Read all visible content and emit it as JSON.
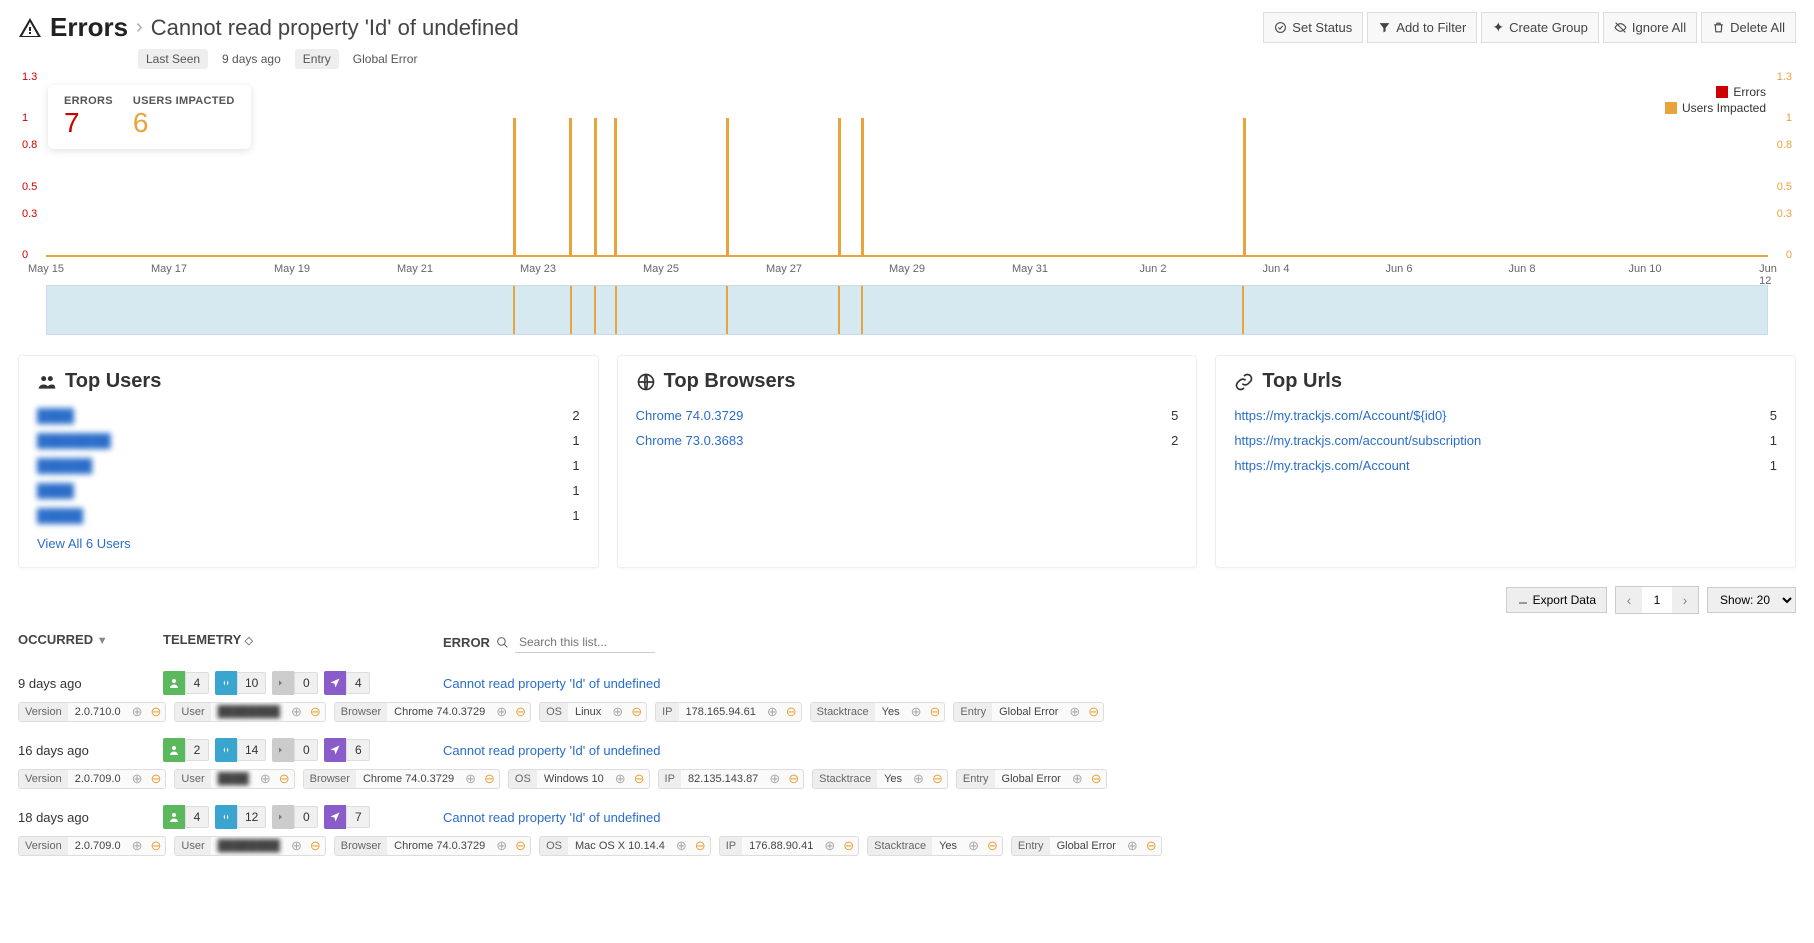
{
  "header": {
    "title": "Errors",
    "description": "Cannot read property 'Id' of undefined",
    "meta": {
      "lastSeenLabel": "Last Seen",
      "lastSeenValue": "9 days ago",
      "entryLabel": "Entry",
      "entryValue": "Global Error"
    },
    "actions": {
      "setStatus": "Set Status",
      "addFilter": "Add to Filter",
      "createGroup": "Create Group",
      "ignoreAll": "Ignore All",
      "deleteAll": "Delete All"
    }
  },
  "stats": {
    "errorsLabel": "ERRORS",
    "errorsValue": "7",
    "usersLabel": "USERS IMPACTED",
    "usersValue": "6"
  },
  "legend": {
    "errors": "Errors",
    "users": "Users Impacted"
  },
  "chart_data": {
    "type": "bar",
    "ylabel_left": "Errors",
    "ylabel_right": "Users Impacted",
    "ylim": [
      0,
      1.3
    ],
    "y_ticks": [
      "0",
      "0.3",
      "0.5",
      "0.8",
      "1",
      "1.3"
    ],
    "x_ticks": [
      "May 15",
      "May 17",
      "May 19",
      "May 21",
      "May 23",
      "May 25",
      "May 27",
      "May 29",
      "May 31",
      "Jun 2",
      "Jun 4",
      "Jun 6",
      "Jun 8",
      "Jun 10",
      "Jun 12"
    ],
    "series": [
      {
        "name": "Errors",
        "color": "#c00",
        "points": []
      },
      {
        "name": "Users Impacted",
        "color": "#e8a33d",
        "points": [
          {
            "x": "May 21",
            "value": 1
          },
          {
            "x": "May 22",
            "value": 1
          },
          {
            "x": "May 22.5",
            "value": 1
          },
          {
            "x": "May 23",
            "value": 1
          },
          {
            "x": "May 25",
            "value": 1
          },
          {
            "x": "May 27",
            "value": 1
          },
          {
            "x": "May 27.3",
            "value": 1
          },
          {
            "x": "Jun 3",
            "value": 1
          }
        ]
      }
    ],
    "bar_positions_pct": [
      27.1,
      30.4,
      31.8,
      33.0,
      39.5,
      46.0,
      47.3,
      69.5
    ]
  },
  "topUsers": {
    "title": "Top Users",
    "rows": [
      {
        "name": "████",
        "count": "2"
      },
      {
        "name": "████████",
        "count": "1"
      },
      {
        "name": "██████",
        "count": "1"
      },
      {
        "name": "████",
        "count": "1"
      },
      {
        "name": "█████",
        "count": "1"
      }
    ],
    "viewAll": "View All 6 Users"
  },
  "topBrowsers": {
    "title": "Top Browsers",
    "rows": [
      {
        "name": "Chrome 74.0.3729",
        "count": "5"
      },
      {
        "name": "Chrome 73.0.3683",
        "count": "2"
      }
    ]
  },
  "topUrls": {
    "title": "Top Urls",
    "rows": [
      {
        "name": "https://my.trackjs.com/Account/${id0}",
        "count": "5"
      },
      {
        "name": "https://my.trackjs.com/account/subscription",
        "count": "1"
      },
      {
        "name": "https://my.trackjs.com/Account",
        "count": "1"
      }
    ]
  },
  "listControls": {
    "export": "Export Data",
    "page": "1",
    "showLabel": "Show: 20"
  },
  "listHeader": {
    "occurred": "OCCURRED",
    "telemetry": "TELEMETRY",
    "error": "ERROR",
    "searchPlaceholder": "Search this list..."
  },
  "rows": [
    {
      "occurred": "9 days ago",
      "telemetry": {
        "user": "4",
        "network": "10",
        "console": "0",
        "nav": "4"
      },
      "error": "Cannot read property 'Id' of undefined",
      "tags": [
        {
          "k": "Version",
          "v": "2.0.710.0"
        },
        {
          "k": "User",
          "v": "████████",
          "blur": true
        },
        {
          "k": "Browser",
          "v": "Chrome 74.0.3729"
        },
        {
          "k": "OS",
          "v": "Linux"
        },
        {
          "k": "IP",
          "v": "178.165.94.61"
        },
        {
          "k": "Stacktrace",
          "v": "Yes"
        },
        {
          "k": "Entry",
          "v": "Global Error"
        }
      ]
    },
    {
      "occurred": "16 days ago",
      "telemetry": {
        "user": "2",
        "network": "14",
        "console": "0",
        "nav": "6"
      },
      "error": "Cannot read property 'Id' of undefined",
      "tags": [
        {
          "k": "Version",
          "v": "2.0.709.0"
        },
        {
          "k": "User",
          "v": "████",
          "blur": true
        },
        {
          "k": "Browser",
          "v": "Chrome 74.0.3729"
        },
        {
          "k": "OS",
          "v": "Windows 10"
        },
        {
          "k": "IP",
          "v": "82.135.143.87"
        },
        {
          "k": "Stacktrace",
          "v": "Yes"
        },
        {
          "k": "Entry",
          "v": "Global Error"
        }
      ]
    },
    {
      "occurred": "18 days ago",
      "telemetry": {
        "user": "4",
        "network": "12",
        "console": "0",
        "nav": "7"
      },
      "error": "Cannot read property 'Id' of undefined",
      "tags": [
        {
          "k": "Version",
          "v": "2.0.709.0"
        },
        {
          "k": "User",
          "v": "████████",
          "blur": true
        },
        {
          "k": "Browser",
          "v": "Chrome 74.0.3729"
        },
        {
          "k": "OS",
          "v": "Mac OS X 10.14.4"
        },
        {
          "k": "IP",
          "v": "176.88.90.41"
        },
        {
          "k": "Stacktrace",
          "v": "Yes"
        },
        {
          "k": "Entry",
          "v": "Global Error"
        }
      ]
    }
  ]
}
